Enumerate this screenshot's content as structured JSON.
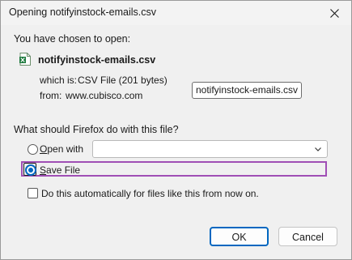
{
  "dialog": {
    "title": "Opening notifyinstock-emails.csv",
    "intro": "You have chosen to open:",
    "file": {
      "icon": "csv-file-icon",
      "name": "notifyinstock-emails.csv",
      "which_is_label": "which is:",
      "which_is_value": "CSV File (201 bytes)",
      "from_label": "from:",
      "from_value": "www.cubisco.com"
    },
    "tooltip": "notifyinstock-emails.csv",
    "question": "What should Firefox do with this file?",
    "open_with": {
      "label_accel": "O",
      "label_rest": "pen with",
      "selected": false,
      "app_value": ""
    },
    "save_file": {
      "label_accel": "S",
      "label_rest": "ave File",
      "selected": true
    },
    "auto_checkbox": {
      "label": "Do this automatically for files like this from now on.",
      "checked": false
    },
    "buttons": {
      "ok": "OK",
      "cancel": "Cancel"
    }
  }
}
